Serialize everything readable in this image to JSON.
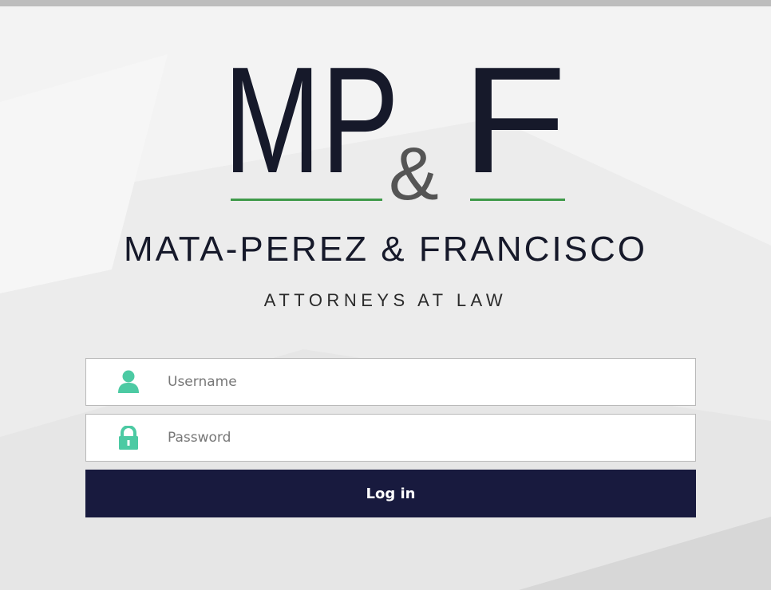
{
  "logo": {
    "monogram_left": "MP",
    "monogram_right": "F",
    "ampersand": "&",
    "firm_name": "MATA-PEREZ & FRANCISCO",
    "tagline": "ATTORNEYS AT LAW"
  },
  "form": {
    "username": {
      "placeholder": "Username",
      "icon": "user-icon",
      "value": ""
    },
    "password": {
      "placeholder": "Password",
      "icon": "lock-icon",
      "value": ""
    },
    "submit_label": "Log in"
  },
  "colors": {
    "brand_dark": "#181a3e",
    "logo_text": "#16192a",
    "accent_green": "#3f9a4a",
    "icon_teal": "#4ccaa3",
    "ampersand_gray": "#555555"
  }
}
